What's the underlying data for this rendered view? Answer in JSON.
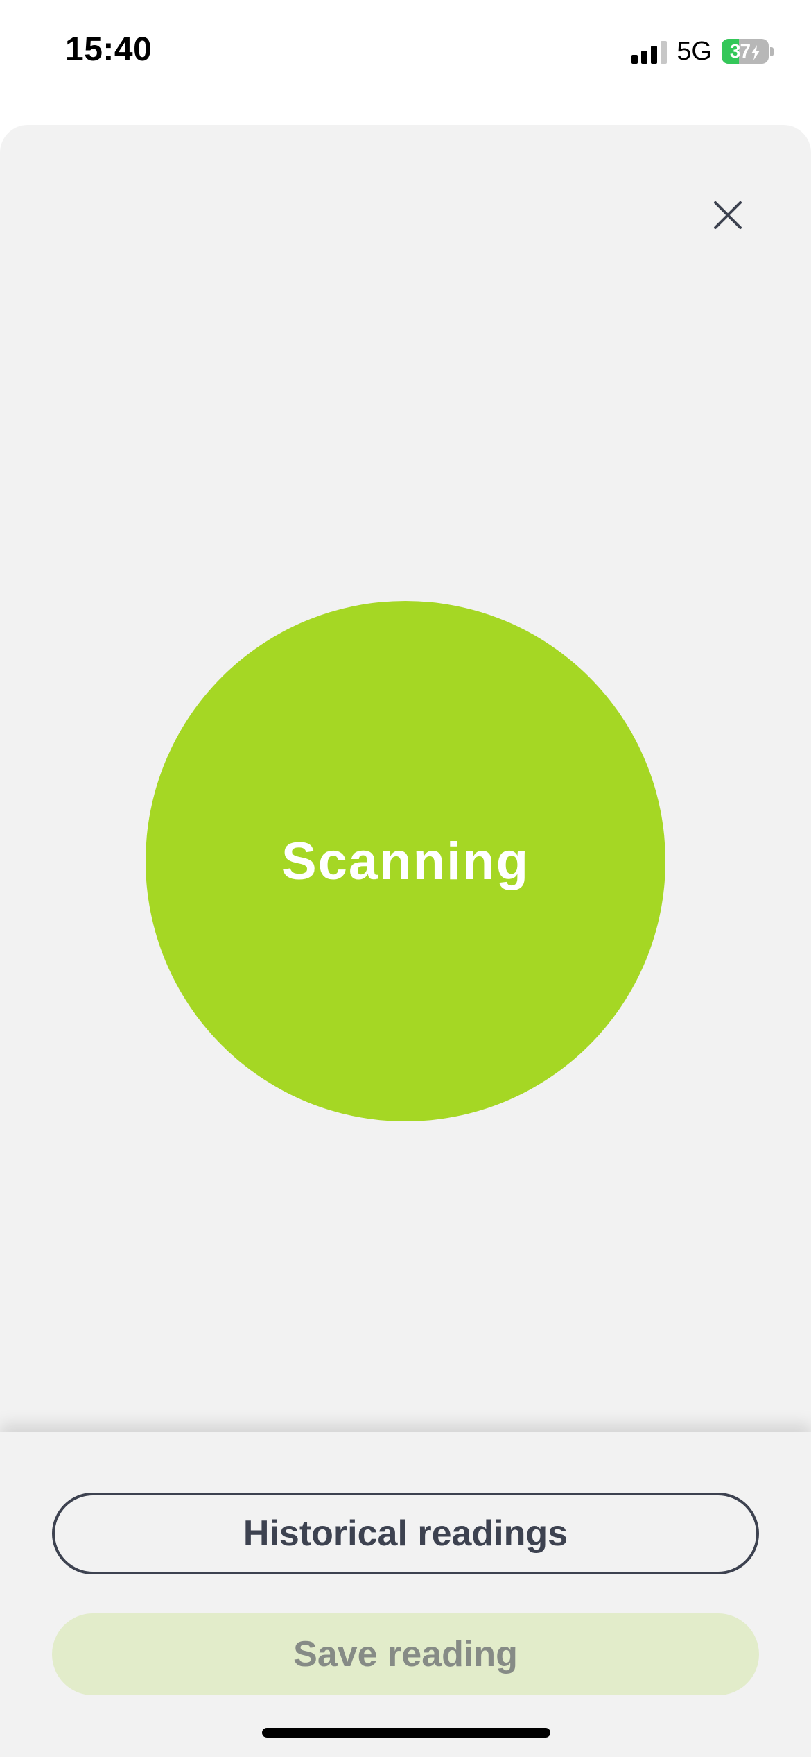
{
  "status_bar": {
    "time": "15:40",
    "network": "5G",
    "battery_percent": "37",
    "battery_level": 0.37,
    "battery_charging": true,
    "signal_bars_active": 3,
    "signal_bars_total": 4
  },
  "colors": {
    "accent": "#a5d724",
    "sheet_background": "#f2f2f2",
    "primary_text": "#3d4250",
    "disabled_button_bg": "#e2ecca"
  },
  "icons": {
    "close": "close-icon",
    "signal": "signal-icon",
    "battery": "battery-charging-icon"
  },
  "scan": {
    "label": "Scanning"
  },
  "actions": {
    "historical_label": "Historical readings",
    "save_label": "Save reading",
    "save_enabled": false
  }
}
